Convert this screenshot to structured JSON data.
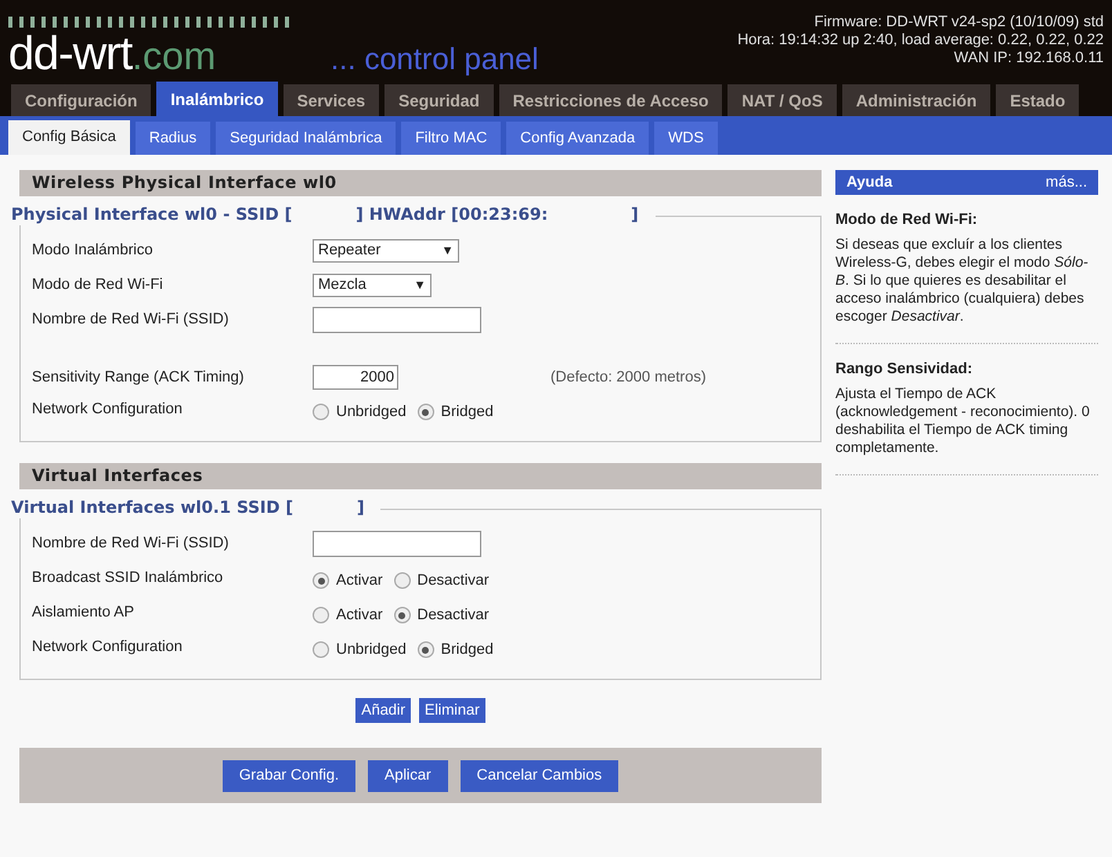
{
  "header": {
    "logo_main": "dd-wrt",
    "logo_domain": ".com",
    "subtitle": "... control panel",
    "firmware": "Firmware: DD-WRT v24-sp2 (10/10/09) std",
    "uptime": "Hora: 19:14:32 up 2:40, load average: 0.22, 0.22, 0.22",
    "wan_ip": "WAN IP: 192.168.0.11"
  },
  "tabs": [
    {
      "label": "Configuración",
      "selected": false
    },
    {
      "label": "Inalámbrico",
      "selected": true
    },
    {
      "label": "Services",
      "selected": false
    },
    {
      "label": "Seguridad",
      "selected": false
    },
    {
      "label": "Restricciones de Acceso",
      "selected": false
    },
    {
      "label": "NAT / QoS",
      "selected": false
    },
    {
      "label": "Administración",
      "selected": false
    },
    {
      "label": "Estado",
      "selected": false
    }
  ],
  "subtabs": [
    {
      "label": "Config Básica",
      "selected": true
    },
    {
      "label": "Radius",
      "selected": false
    },
    {
      "label": "Seguridad Inalámbrica",
      "selected": false
    },
    {
      "label": "Filtro MAC",
      "selected": false
    },
    {
      "label": "Config Avanzada",
      "selected": false
    },
    {
      "label": "WDS",
      "selected": false
    }
  ],
  "sections": [
    {
      "title": "Wireless Physical Interface wl0",
      "legend": [
        "Physical Interface wl0 - SSID [",
        "] HWAddr [00:23:69:",
        "]"
      ],
      "rows": [
        {
          "kind": "select",
          "label": "Modo Inalámbrico",
          "value": "Repeater",
          "arrow": "▼"
        },
        {
          "kind": "select",
          "label": "Modo de Red Wi-Fi",
          "value": "Mezcla",
          "arrow": "▼"
        },
        {
          "kind": "text",
          "label": "Nombre de Red Wi-Fi (SSID)"
        },
        {
          "kind": "number",
          "label": "Sensitivity Range (ACK Timing)",
          "value": "2000",
          "note": "(Defecto: 2000 metros)"
        },
        {
          "kind": "radio",
          "label": "Network Configuration",
          "options": [
            {
              "label": "Unbridged",
              "selected": false
            },
            {
              "label": "Bridged",
              "selected": true
            }
          ]
        }
      ]
    },
    {
      "title": "Virtual Interfaces",
      "legend": [
        "Virtual Interfaces wl0.1 SSID [",
        "]"
      ],
      "rows": [
        {
          "kind": "text",
          "label": "Nombre de Red Wi-Fi (SSID)"
        },
        {
          "kind": "radio",
          "label": "Broadcast SSID Inalámbrico",
          "options": [
            {
              "label": "Activar",
              "selected": true
            },
            {
              "label": "Desactivar",
              "selected": false
            }
          ]
        },
        {
          "kind": "radio",
          "label": "Aislamiento AP",
          "options": [
            {
              "label": "Activar",
              "selected": false
            },
            {
              "label": "Desactivar",
              "selected": true
            }
          ]
        },
        {
          "kind": "radio",
          "label": "Network Configuration",
          "options": [
            {
              "label": "Unbridged",
              "selected": false
            },
            {
              "label": "Bridged",
              "selected": true
            }
          ]
        }
      ],
      "buttons": [
        "Añadir",
        "Eliminar"
      ]
    }
  ],
  "footer_buttons": [
    "Grabar Config.",
    "Aplicar",
    "Cancelar Cambios"
  ],
  "help": {
    "title": "Ayuda",
    "more": "más...",
    "items": [
      {
        "heading": "Modo de Red Wi-Fi:",
        "text": "Si deseas que excluír a los clientes Wireless-G, debes elegir el modo *Sólo-B*. Si lo que quieres es desabilitar el acceso inalámbrico (cualquiera) debes escoger *Desactivar*."
      },
      {
        "heading": "Rango Sensividad:",
        "text": "Ajusta el Tiempo de ACK (acknowledgement - reconocimiento). 0 deshabilita el Tiempo de ACK timing completamente."
      }
    ]
  }
}
